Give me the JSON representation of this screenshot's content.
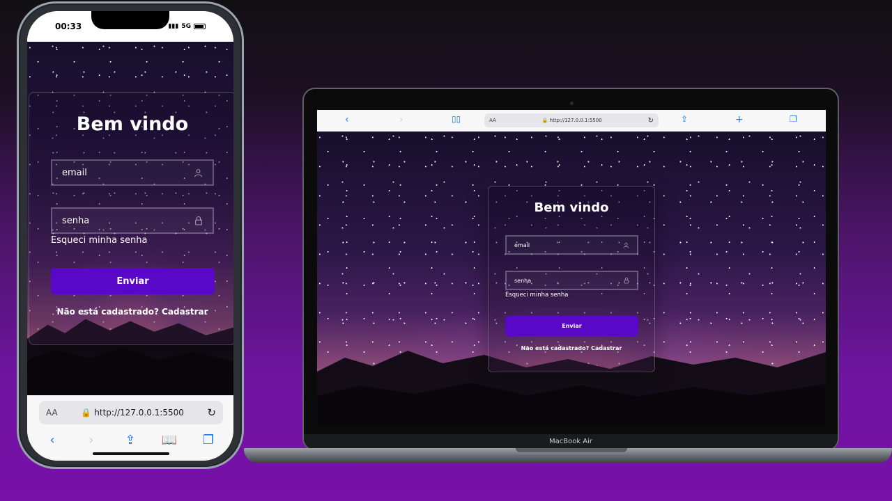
{
  "colors": {
    "accent_button": "#5a08c8",
    "background_top": "#121013",
    "background_bottom": "#7810aa",
    "safari_link_blue": "#1878f5"
  },
  "phone": {
    "status_time": "00:33",
    "status_network": "5G",
    "card": {
      "title": "Bem vindo",
      "email_placeholder": "email",
      "email_icon": "user-icon",
      "password_placeholder": "senha",
      "password_icon": "lock-icon",
      "forgot_link": "Esqueci minha senha",
      "submit_label": "Enviar",
      "signup_prompt": "Não está cadastrado?",
      "signup_link": "Cadastrar"
    },
    "browser": {
      "text_size_label": "AA",
      "url": "http://127.0.0.1:5500"
    }
  },
  "laptop": {
    "model_label": "MacBook Air",
    "browser": {
      "text_size_label": "AA",
      "url": "http://127.0.0.1:5500"
    },
    "card": {
      "title": "Bem vindo",
      "email_placeholder": "email",
      "email_icon": "user-icon",
      "password_placeholder": "senha",
      "password_icon": "lock-icon",
      "forgot_link": "Esqueci minha senha",
      "submit_label": "Enviar",
      "signup_prompt": "Não está cadastrado?",
      "signup_link": "Cadastrar"
    }
  }
}
